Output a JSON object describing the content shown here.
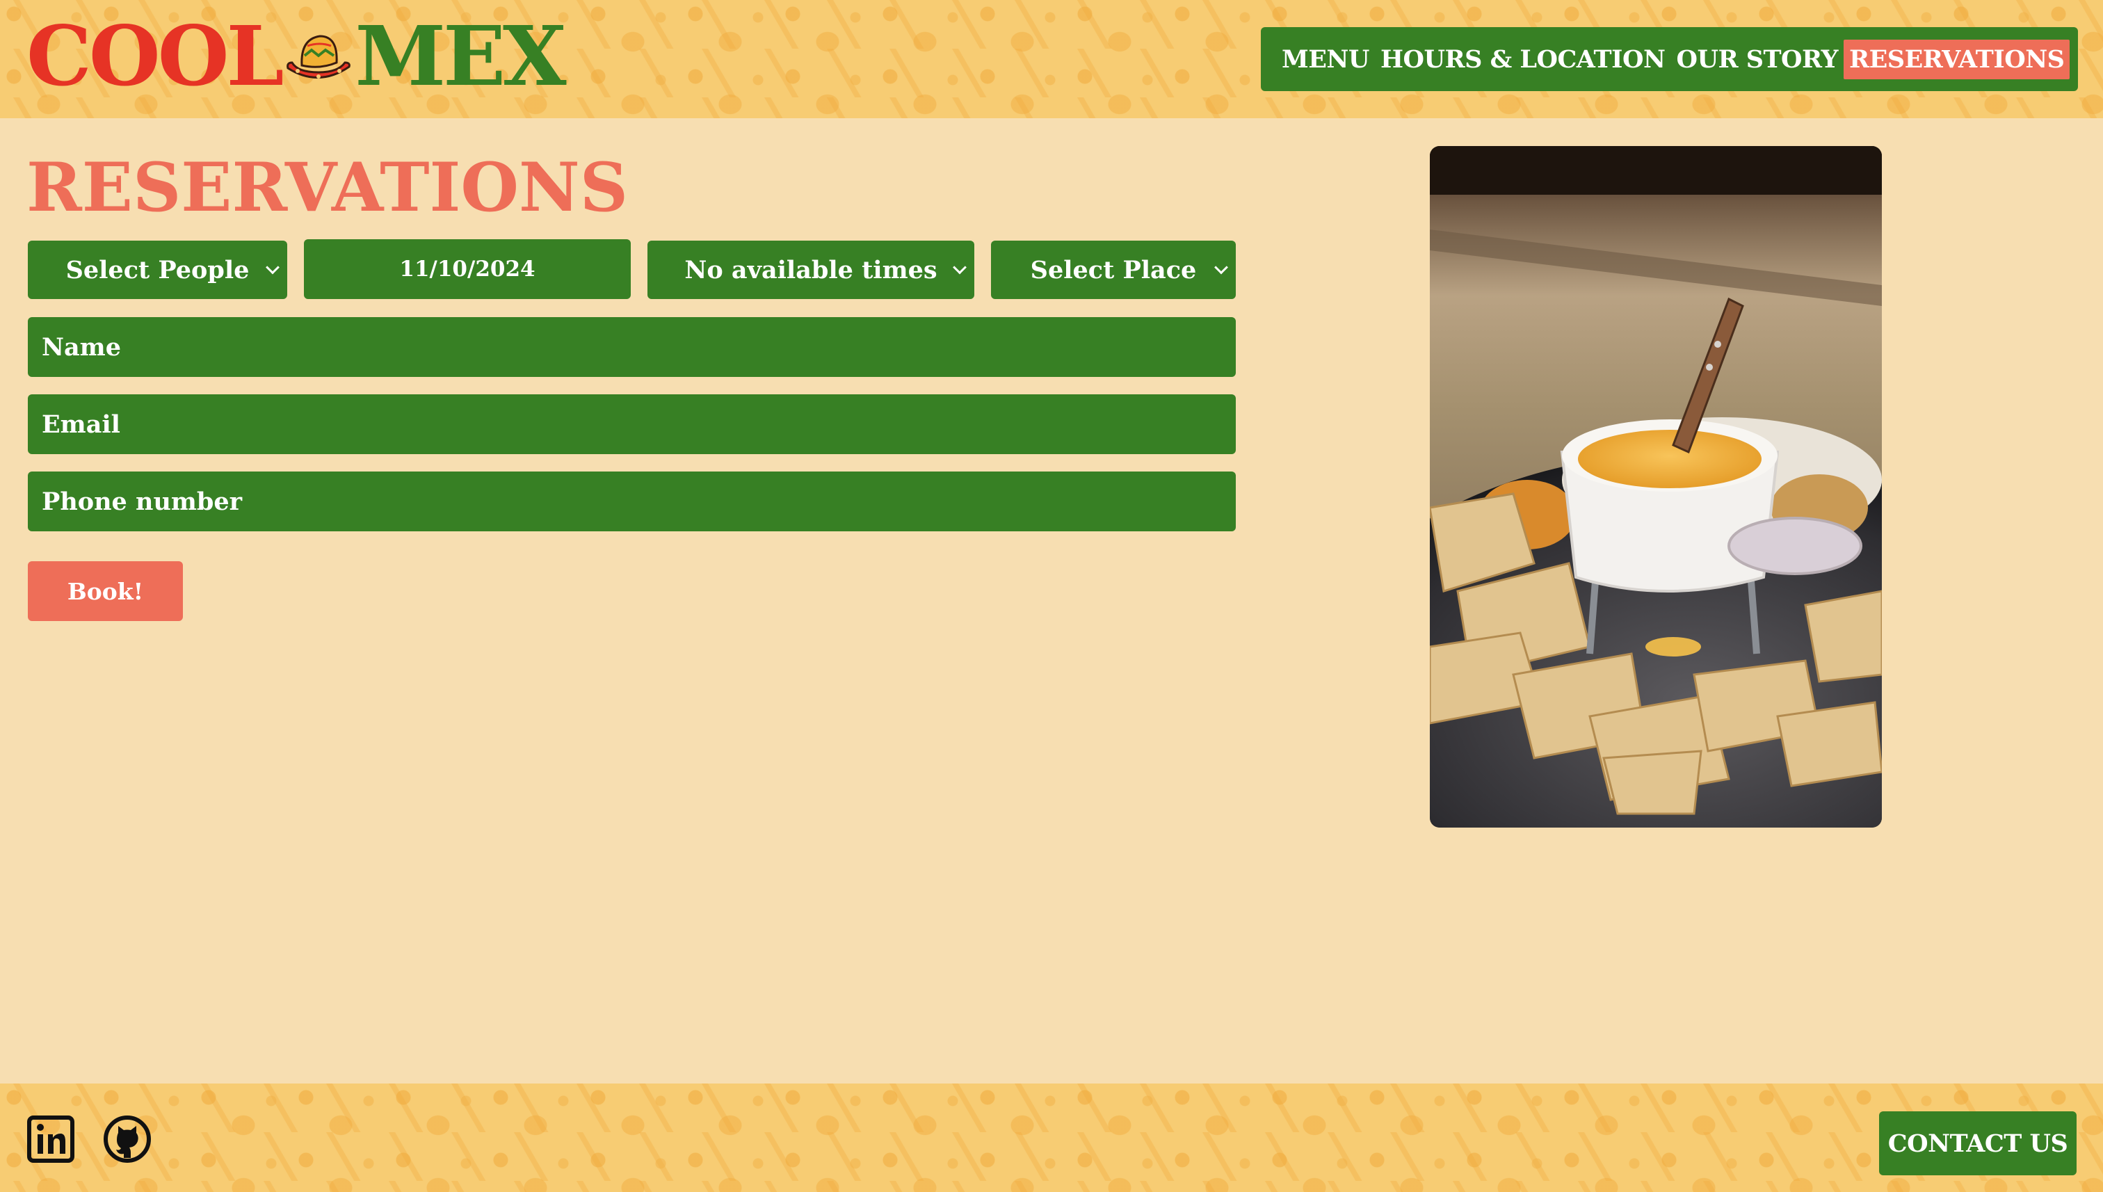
{
  "brand": {
    "part1": "COOL",
    "part2": "MEX",
    "icon": "sombrero-icon"
  },
  "nav": {
    "items": [
      {
        "label": "MENU",
        "active": false
      },
      {
        "label": "HOURS & LOCATION",
        "active": false
      },
      {
        "label": "OUR STORY",
        "active": false
      },
      {
        "label": "RESERVATIONS",
        "active": true
      }
    ]
  },
  "page": {
    "title": "RESERVATIONS"
  },
  "form": {
    "people": {
      "value": "Select People"
    },
    "date": {
      "value": "11/10/2024"
    },
    "time": {
      "value": "No available times"
    },
    "place": {
      "value": "Select Place"
    },
    "name": {
      "placeholder": "Name"
    },
    "email": {
      "placeholder": "Email"
    },
    "phone": {
      "placeholder": "Phone number"
    },
    "submit_label": "Book!"
  },
  "photo": {
    "subject": "queso dip with tortilla chips"
  },
  "footer": {
    "social": [
      "linkedin-icon",
      "github-icon"
    ],
    "contact_label": "CONTACT US"
  },
  "colors": {
    "green": "#378024",
    "coral": "#ee6e58",
    "red": "#e63325",
    "background": "#f7deb1",
    "pattern": "#f7cc73"
  }
}
